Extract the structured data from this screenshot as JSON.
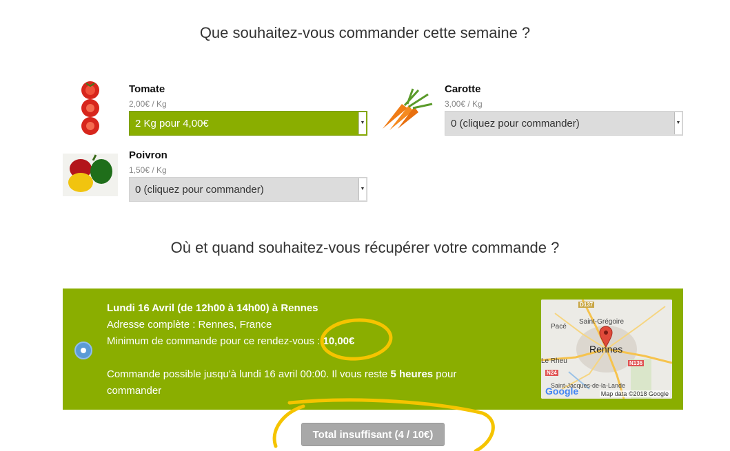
{
  "order_section": {
    "title": "Que souhaitez-vous commander cette semaine ?"
  },
  "products": [
    {
      "name": "Tomate",
      "price": "2,00€ / Kg",
      "selection": "2 Kg pour 4,00€"
    },
    {
      "name": "Carotte",
      "price": "3,00€ / Kg",
      "selection": "0 (cliquez pour commander)"
    },
    {
      "name": "Poivron",
      "price": "1,50€ / Kg",
      "selection": "0 (cliquez pour commander)"
    }
  ],
  "pickup_section": {
    "title": "Où et quand souhaitez-vous récupérer votre commande ?"
  },
  "pickup": {
    "title": "Lundi 16 Avril (de 12h00 à 14h00) à Rennes",
    "address": "Adresse complète : Rennes, France",
    "minimum_label": "Minimum de commande pour ce rendez-vous : ",
    "minimum_value": "10,00€",
    "deadline_text": "Commande possible jusqu'à lundi 16 avril 00:00. Il vous reste ",
    "deadline_remaining": "5 heures",
    "deadline_suffix": " pour",
    "deadline_line2": "commander",
    "selected": true
  },
  "map": {
    "labels": {
      "d137": "D137",
      "saint_gregoire": "Saint-Grégoire",
      "pace": "Pacé",
      "rennes": "Rennes",
      "le_rheu": "Le Rheu",
      "n136": "N136",
      "n24": "N24",
      "saint_jacques": "Saint-Jacques-de-la-Lande"
    },
    "credit": "Map data ©2018 Google",
    "logo": "Google"
  },
  "total_button": {
    "label": "Total insuffisant (4 / 10€)"
  },
  "colors": {
    "accent_green": "#8aae00",
    "radio_blue": "#5b9bd5",
    "annotation_yellow": "#f5c400",
    "button_grey": "#a8a8a8"
  },
  "icons": [
    "tomato-image",
    "carrot-image",
    "pepper-image",
    "dropdown-arrow-icon",
    "map-pin-icon"
  ]
}
